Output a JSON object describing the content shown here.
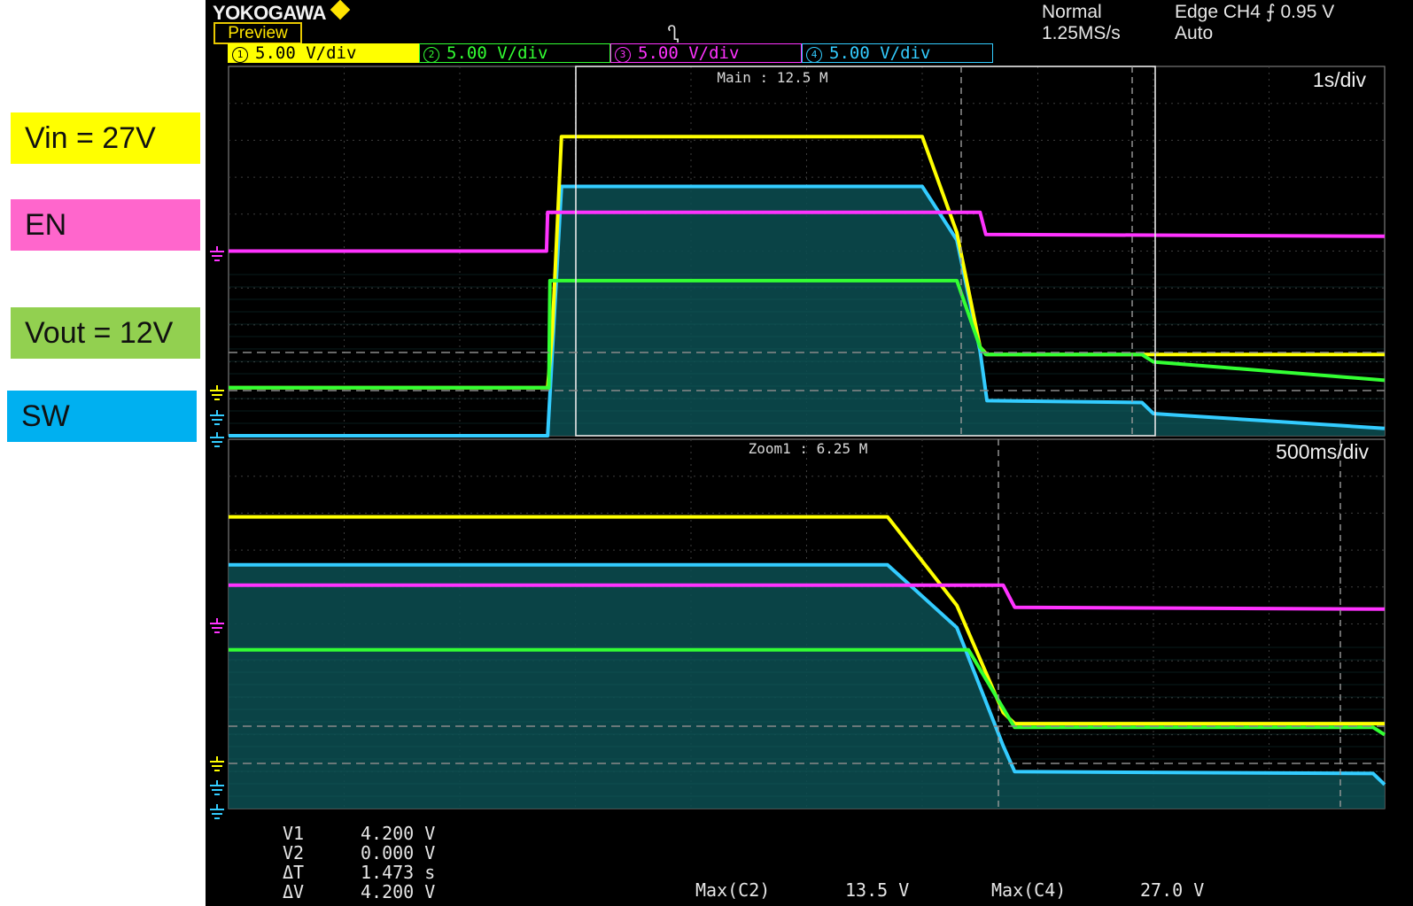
{
  "legend": [
    {
      "label": "Vin = 27V",
      "color": "#ffff00"
    },
    {
      "label": "EN",
      "color": "#ff66cc"
    },
    {
      "label": "Vout = 12V",
      "color": "#92d050"
    },
    {
      "label": "SW",
      "color": "#00b0f0"
    }
  ],
  "scope": {
    "brand": "YOKOGAWA",
    "preview": "Preview",
    "trigger_marker": "Ⴂ",
    "acq_mode": "Normal",
    "sample_rate": "1.25MS/s",
    "trigger": "Edge CH4 ⨍ 0.95 V",
    "trigger_mode": "Auto",
    "channels": [
      {
        "num": "1",
        "scale": "5.00 V/div",
        "color": "#ffff00",
        "bg": "#ffff00",
        "fg": "#000000"
      },
      {
        "num": "2",
        "scale": "5.00 V/div",
        "color": "#33ff33",
        "bg": "#000000",
        "fg": "#33ff33"
      },
      {
        "num": "3",
        "scale": "5.00 V/div",
        "color": "#ff33ff",
        "bg": "#000000",
        "fg": "#ff33ff"
      },
      {
        "num": "4",
        "scale": "5.00 V/div",
        "color": "#33ccff",
        "bg": "#000000",
        "fg": "#33ccff"
      }
    ]
  },
  "chart_data": [
    {
      "type": "line",
      "panel": "main",
      "title": "Main : 12.5 M",
      "timebase": "1s/div",
      "xlabel": "",
      "ylabel": "",
      "x_unit": "s",
      "xlim": [
        0,
        10
      ],
      "y_unit": "div",
      "ylim": [
        0,
        10
      ],
      "series": [
        {
          "color": "#ffff00",
          "x": [
            0,
            2.76,
            2.8,
            2.88,
            6.0,
            6.3,
            6.5,
            6.56,
            10
          ],
          "y": [
            1.3,
            1.3,
            2.8,
            8.1,
            8.1,
            5.5,
            2.4,
            2.2,
            2.2
          ]
        },
        {
          "color": "#33ff33",
          "x": [
            0,
            2.77,
            2.78,
            2.88,
            6.3,
            6.5,
            6.55,
            7.9,
            8.0,
            10
          ],
          "y": [
            1.3,
            1.3,
            4.2,
            4.2,
            4.2,
            2.4,
            2.2,
            2.2,
            2.0,
            1.5
          ]
        },
        {
          "color": "#ff33ff",
          "x": [
            0,
            2.75,
            2.76,
            6.5,
            6.55,
            10
          ],
          "y": [
            5.0,
            5.0,
            6.05,
            6.05,
            5.45,
            5.4
          ]
        },
        {
          "color": "#33ccff",
          "x": [
            0,
            2.76,
            2.88,
            6.0,
            6.3,
            6.5,
            6.56,
            7.9,
            8.0,
            10
          ],
          "y": [
            0,
            0,
            6.75,
            6.75,
            5.3,
            2.3,
            0.95,
            0.9,
            0.6,
            0.2
          ]
        }
      ]
    },
    {
      "type": "line",
      "panel": "zoom",
      "title": "Zoom1 : 6.25 M",
      "timebase": "500ms/div",
      "xlabel": "",
      "ylabel": "",
      "x_unit": "s",
      "xlim": [
        0,
        5
      ],
      "y_unit": "div",
      "ylim": [
        0,
        10
      ],
      "series": [
        {
          "color": "#ffff00",
          "x": [
            0,
            2.85,
            3.15,
            3.35,
            3.4,
            5
          ],
          "y": [
            7.9,
            7.9,
            5.5,
            2.6,
            2.3,
            2.3
          ]
        },
        {
          "color": "#33ff33",
          "x": [
            0,
            3.2,
            3.38,
            3.4,
            4.95,
            5
          ],
          "y": [
            4.3,
            4.3,
            2.4,
            2.2,
            2.2,
            2.0
          ]
        },
        {
          "color": "#ff33ff",
          "x": [
            0,
            3.35,
            3.4,
            5
          ],
          "y": [
            6.05,
            6.05,
            5.45,
            5.4
          ]
        },
        {
          "color": "#33ccff",
          "x": [
            0,
            2.85,
            3.15,
            3.35,
            3.4,
            4.95,
            5
          ],
          "y": [
            6.6,
            6.6,
            4.9,
            1.7,
            1.0,
            0.95,
            0.65
          ]
        }
      ]
    }
  ],
  "panels": {
    "main": {
      "title": "Main : 12.5 M",
      "timebase": "1s/div"
    },
    "zoom": {
      "title": "Zoom1 : 6.25 M",
      "timebase": "500ms/div"
    }
  },
  "cursors": {
    "labels": [
      "V1",
      "V2",
      "ΔT",
      "ΔV"
    ],
    "values": [
      "4.200 V",
      "0.000 V",
      "1.473 s",
      "4.200 V"
    ]
  },
  "measurements": [
    {
      "label": "Max(C2)",
      "value": "13.5 V"
    },
    {
      "label": "Max(C4)",
      "value": "27.0 V"
    }
  ]
}
